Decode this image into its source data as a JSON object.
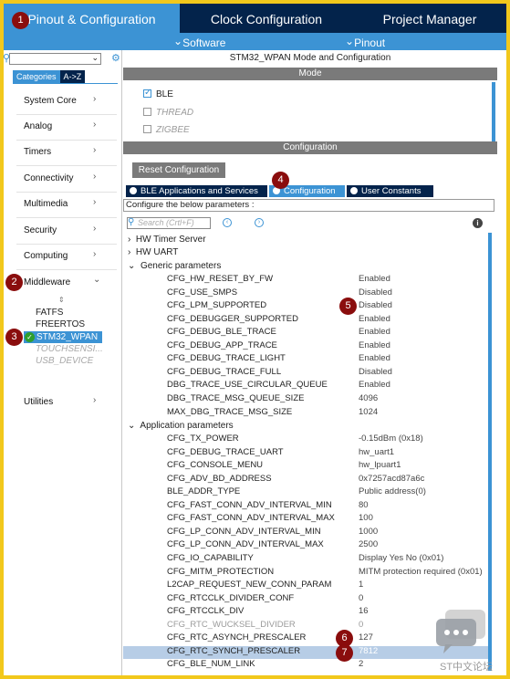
{
  "top_tabs": [
    {
      "label": "Pinout & Configuration",
      "active": true
    },
    {
      "label": "Clock Configuration",
      "active": false
    },
    {
      "label": "Project Manager",
      "active": false
    }
  ],
  "sub_menu": {
    "software_packs": "Software Packs",
    "pinout": "Pinout"
  },
  "badges": [
    "1",
    "2",
    "3",
    "4",
    "5",
    "6",
    "7"
  ],
  "left_panel": {
    "tabs": [
      "Categories",
      "A->Z"
    ],
    "categories": [
      "System Core",
      "Analog",
      "Timers",
      "Connectivity",
      "Multimedia",
      "Security",
      "Computing",
      "Middleware",
      "Utilities"
    ],
    "middleware_items": [
      {
        "label": "FATFS",
        "state": "normal"
      },
      {
        "label": "FREERTOS",
        "state": "normal"
      },
      {
        "label": "STM32_WPAN",
        "state": "selected"
      },
      {
        "label": "TOUCHSENSI...",
        "state": "disabled"
      },
      {
        "label": "USB_DEVICE",
        "state": "disabled"
      }
    ]
  },
  "mode_panel": {
    "title": "STM32_WPAN Mode and Configuration",
    "mode_header": "Mode",
    "modes": [
      {
        "label": "BLE",
        "checked": true,
        "enabled": true
      },
      {
        "label": "THREAD",
        "checked": false,
        "enabled": false
      },
      {
        "label": "ZIGBEE",
        "checked": false,
        "enabled": false
      }
    ],
    "config_header": "Configuration"
  },
  "config": {
    "reset_button": "Reset Configuration",
    "tabs": [
      "BLE Applications and Services",
      "Configuration",
      "User Constants"
    ],
    "configure_label": "Configure the below parameters :",
    "search_placeholder": "Search (Crtl+F)",
    "collapsed_groups": [
      "HW Timer Server",
      "HW UART"
    ],
    "generic_title": "Generic parameters",
    "generic": [
      {
        "k": "CFG_HW_RESET_BY_FW",
        "v": "Enabled"
      },
      {
        "k": "CFG_USE_SMPS",
        "v": "Disabled"
      },
      {
        "k": "CFG_LPM_SUPPORTED",
        "v": "Disabled"
      },
      {
        "k": "CFG_DEBUGGER_SUPPORTED",
        "v": "Enabled"
      },
      {
        "k": "CFG_DEBUG_BLE_TRACE",
        "v": "Enabled"
      },
      {
        "k": "CFG_DEBUG_APP_TRACE",
        "v": "Enabled"
      },
      {
        "k": "CFG_DEBUG_TRACE_LIGHT",
        "v": "Enabled"
      },
      {
        "k": "CFG_DEBUG_TRACE_FULL",
        "v": "Disabled"
      },
      {
        "k": "DBG_TRACE_USE_CIRCULAR_QUEUE",
        "v": "Enabled"
      },
      {
        "k": "DBG_TRACE_MSG_QUEUE_SIZE",
        "v": "4096"
      },
      {
        "k": "MAX_DBG_TRACE_MSG_SIZE",
        "v": "1024"
      }
    ],
    "app_title": "Application parameters",
    "app": [
      {
        "k": "CFG_TX_POWER",
        "v": "-0.15dBm (0x18)"
      },
      {
        "k": "CFG_DEBUG_TRACE_UART",
        "v": "hw_uart1"
      },
      {
        "k": "CFG_CONSOLE_MENU",
        "v": "hw_lpuart1"
      },
      {
        "k": "CFG_ADV_BD_ADDRESS",
        "v": "0x7257acd87a6c"
      },
      {
        "k": "BLE_ADDR_TYPE",
        "v": "Public address(0)"
      },
      {
        "k": "CFG_FAST_CONN_ADV_INTERVAL_MIN",
        "v": "80"
      },
      {
        "k": "CFG_FAST_CONN_ADV_INTERVAL_MAX",
        "v": "100"
      },
      {
        "k": "CFG_LP_CONN_ADV_INTERVAL_MIN",
        "v": "1000"
      },
      {
        "k": "CFG_LP_CONN_ADV_INTERVAL_MAX",
        "v": "2500"
      },
      {
        "k": "CFG_IO_CAPABILITY",
        "v": "Display Yes No (0x01)"
      },
      {
        "k": "CFG_MITM_PROTECTION",
        "v": "MITM protection required (0x01)"
      },
      {
        "k": "L2CAP_REQUEST_NEW_CONN_PARAM",
        "v": "1"
      },
      {
        "k": "CFG_RTCCLK_DIVIDER_CONF",
        "v": "0"
      },
      {
        "k": "CFG_RTCCLK_DIV",
        "v": "16"
      },
      {
        "k": "CFG_RTC_WUCKSEL_DIVIDER",
        "v": "0",
        "dim": true
      },
      {
        "k": "CFG_RTC_ASYNCH_PRESCALER",
        "v": "127"
      },
      {
        "k": "CFG_RTC_SYNCH_PRESCALER",
        "v": "7812",
        "selected": true
      },
      {
        "k": "CFG_BLE_NUM_LINK",
        "v": "2"
      }
    ]
  },
  "watermark": "ST中文论坛",
  "colors": {
    "navy": "#03234b",
    "blue": "#3c93d4",
    "gold": "#f2c81c",
    "badge": "#8a0d0d"
  }
}
